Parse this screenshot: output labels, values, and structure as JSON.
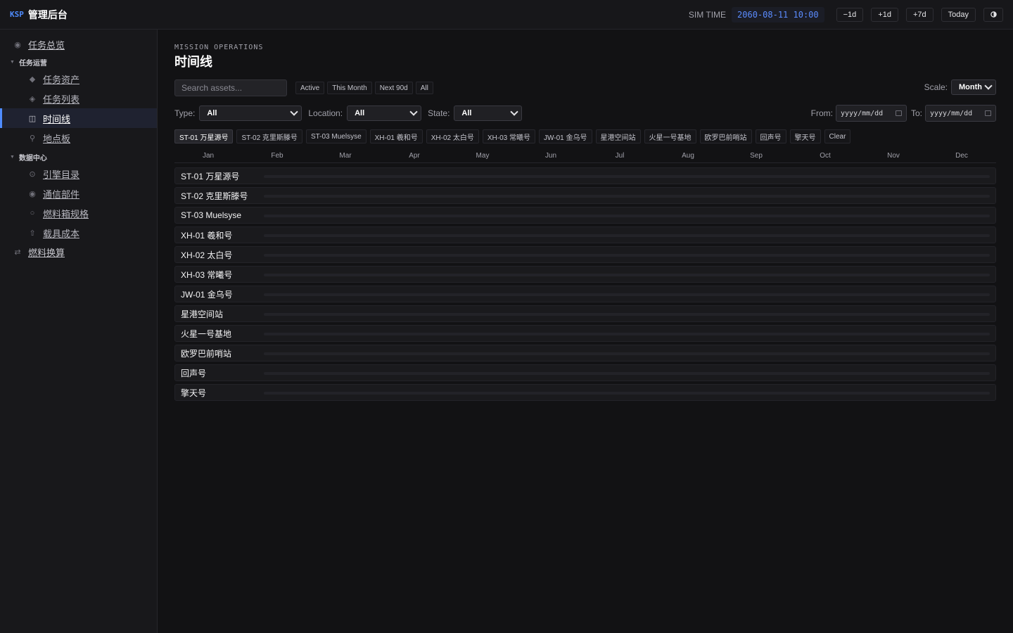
{
  "header": {
    "logo": "KSP",
    "title": "管理后台",
    "sim_time_label": "SIM TIME",
    "sim_time_value": "2060-08-11 10:00",
    "buttons": [
      "−1d",
      "+1d",
      "+7d",
      "Today"
    ],
    "theme_icon": "half-circle-icon"
  },
  "sidebar": {
    "overview": {
      "label": "任务总览",
      "icon": "target-icon"
    },
    "group_ops": {
      "label": "任务运营",
      "icon": "caret-down-icon"
    },
    "ops_items": [
      {
        "label": "任务资产",
        "icon": "diamond-icon"
      },
      {
        "label": "任务列表",
        "icon": "diamond-outline-icon"
      },
      {
        "label": "时间线",
        "icon": "columns-icon"
      },
      {
        "label": "地点板",
        "icon": "pin-icon"
      }
    ],
    "group_data": {
      "label": "数据中心",
      "icon": "caret-down-icon"
    },
    "data_items": [
      {
        "label": "引擎目录",
        "icon": "circle-dot-icon"
      },
      {
        "label": "通信部件",
        "icon": "radio-icon"
      },
      {
        "label": "燃料箱规格",
        "icon": "circle-icon"
      },
      {
        "label": "载具成本",
        "icon": "up-arrow-icon"
      }
    ],
    "fuel_calc": {
      "label": "燃料换算",
      "icon": "swap-icon"
    }
  },
  "main": {
    "eyebrow": "MISSION OPERATIONS",
    "title": "时间线",
    "search_placeholder": "Search assets...",
    "quick_filters": [
      "Active",
      "This Month",
      "Next 90d",
      "All"
    ],
    "scale_label": "Scale:",
    "scale_value": "Month",
    "type_label": "Type:",
    "type_value": "All",
    "location_label": "Location:",
    "location_value": "All",
    "state_label": "State:",
    "state_value": "All",
    "from_label": "From:",
    "to_label": "To:",
    "date_placeholder": "yyyy/mm/dd",
    "asset_chips": [
      "ST-01 万星源号",
      "ST-02 克里斯滕号",
      "ST-03 Muelsyse",
      "XH-01 羲和号",
      "XH-02 太白号",
      "XH-03 常曦号",
      "JW-01 金乌号",
      "星港空间站",
      "火星一号基地",
      "欧罗巴前哨站",
      "回声号",
      "擎天号",
      "Clear"
    ],
    "months": [
      "Jan",
      "Feb",
      "Mar",
      "Apr",
      "May",
      "Jun",
      "Jul",
      "Aug",
      "Sep",
      "Oct",
      "Nov",
      "Dec"
    ],
    "rows": [
      "ST-01 万星源号",
      "ST-02 克里斯滕号",
      "ST-03 Muelsyse",
      "XH-01 羲和号",
      "XH-02 太白号",
      "XH-03 常曦号",
      "JW-01 金乌号",
      "星港空间站",
      "火星一号基地",
      "欧罗巴前哨站",
      "回声号",
      "擎天号"
    ]
  },
  "colors": {
    "accent": "#4f8cff",
    "background": "#121214",
    "sidebar": "#18181b"
  }
}
